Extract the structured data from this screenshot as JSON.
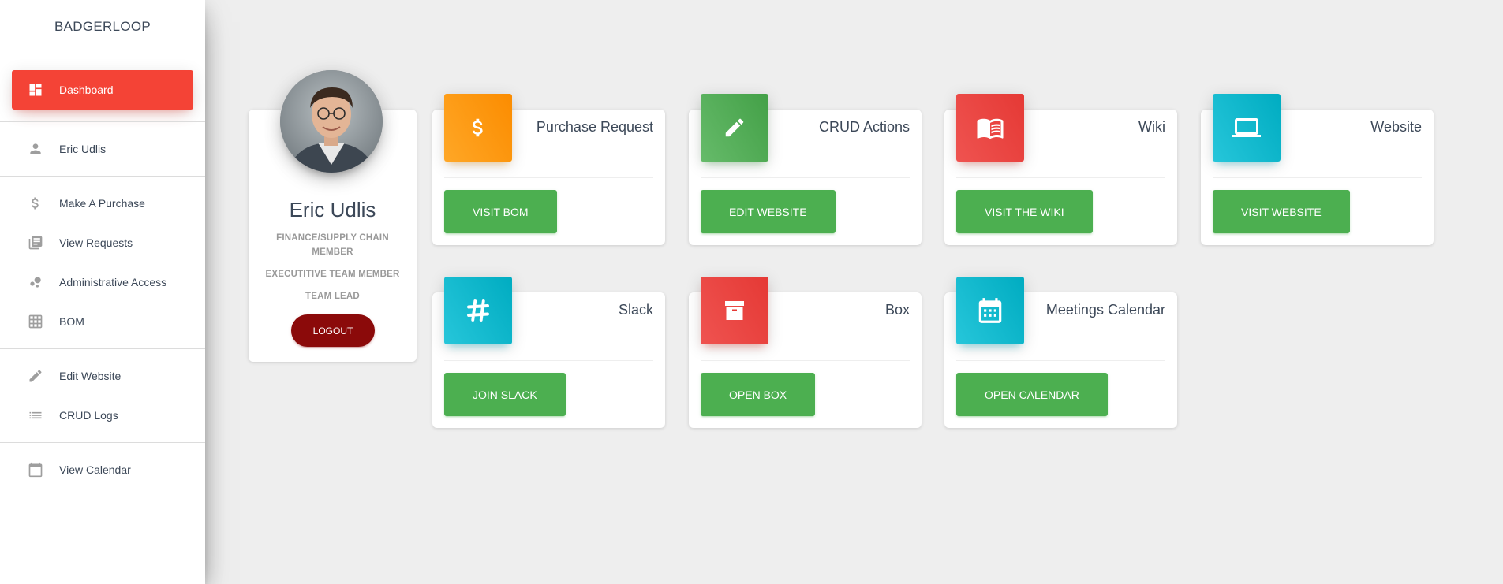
{
  "sidebar": {
    "brand": "BADGERLOOP",
    "items": [
      {
        "label": "Dashboard",
        "icon": "dashboard-icon"
      },
      {
        "label": "Eric Udlis",
        "icon": "person-icon"
      },
      {
        "label": "Make A Purchase",
        "icon": "dollar-icon"
      },
      {
        "label": "View Requests",
        "icon": "library-books-icon"
      },
      {
        "label": "Administrative Access",
        "icon": "bubble-chart-icon"
      },
      {
        "label": "BOM",
        "icon": "grid-icon"
      },
      {
        "label": "Edit Website",
        "icon": "pencil-icon"
      },
      {
        "label": "CRUD Logs",
        "icon": "list-icon"
      },
      {
        "label": "View Calendar",
        "icon": "calendar-icon"
      }
    ]
  },
  "profile": {
    "name": "Eric Udlis",
    "roles": [
      "FINANCE/SUPPLY CHAIN MEMBER",
      "EXECUTITIVE TEAM MEMBER",
      "TEAM LEAD"
    ],
    "logout_label": "LOGOUT"
  },
  "cards": [
    {
      "title": "Purchase Request",
      "button": "VISIT BOM",
      "icon": "dollar-icon",
      "color": "#fb8c00"
    },
    {
      "title": "CRUD Actions",
      "button": "EDIT WEBSITE",
      "icon": "pencil-icon",
      "color": "#43a047"
    },
    {
      "title": "Wiki",
      "button": "VISIT THE WIKI",
      "icon": "book-icon",
      "color": "#e53935"
    },
    {
      "title": "Website",
      "button": "VISIT WEBSITE",
      "icon": "laptop-icon",
      "color": "#00acc1"
    },
    {
      "title": "Slack",
      "button": "JOIN SLACK",
      "icon": "slack-icon",
      "color": "#00acc1"
    },
    {
      "title": "Box",
      "button": "OPEN BOX",
      "icon": "archive-box-icon",
      "color": "#e53935"
    },
    {
      "title": "Meetings Calendar",
      "button": "OPEN CALENDAR",
      "icon": "calendar-icon",
      "color": "#00acc1"
    }
  ],
  "colors": {
    "active_nav": "#f44336",
    "button_green": "#4caf50",
    "logout": "#8b0a0a",
    "background": "#eeeeee"
  }
}
